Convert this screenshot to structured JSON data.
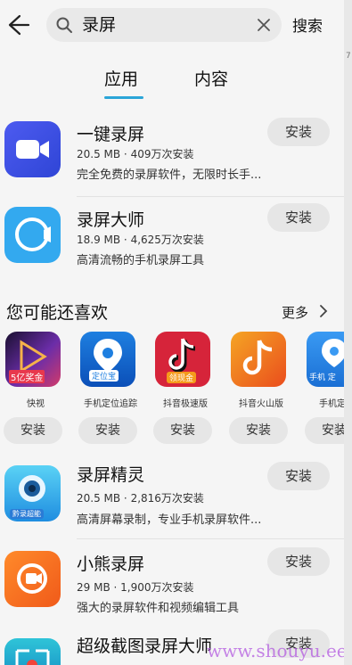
{
  "header": {
    "search_query": "录屏",
    "search_button": "搜索"
  },
  "tabs": [
    {
      "label": "应用",
      "active": true
    },
    {
      "label": "内容",
      "active": false
    }
  ],
  "apps": [
    {
      "title": "一键录屏",
      "meta": "20.5 MB · 409万次安装",
      "desc": "完全免费的录屏软件，无限时长手...",
      "install": "安装"
    },
    {
      "title": "录屏大师",
      "meta": "18.9 MB · 4,625万次安装",
      "desc": "高清流畅的手机录屏工具",
      "install": "安装"
    }
  ],
  "recommend": {
    "title": "您可能还喜欢",
    "more": "更多",
    "items": [
      {
        "label": "快视",
        "icon_text": "5亿奖金",
        "install": "安装"
      },
      {
        "label": "手机定位追踪",
        "icon_text": "定位宝",
        "install": "安装"
      },
      {
        "label": "抖音极速版",
        "icon_text": "领现金",
        "install": "安装"
      },
      {
        "label": "抖音火山版",
        "icon_text": "",
        "install": "安装"
      },
      {
        "label": "手机定位",
        "icon_text": "手机 定",
        "install": "安装"
      }
    ]
  },
  "apps_more": [
    {
      "title": "录屏精灵",
      "meta": "20.5 MB · 2,816万次安装",
      "desc": "高清屏幕录制，专业手机录屏软件...",
      "install": "安装",
      "icon_text": "黔录超能"
    },
    {
      "title": "小熊录屏",
      "meta": "29 MB · 1,900万次安装",
      "desc": "强大的录屏软件和视频编辑工具",
      "install": "安装"
    },
    {
      "title": "超级截图录屏大师",
      "meta": "",
      "desc": "",
      "install": "安装"
    }
  ],
  "watermark": "www.shouyu.ee",
  "colors": {
    "accent": "#2aa5d8",
    "install_bg": "#e6e6e6"
  }
}
